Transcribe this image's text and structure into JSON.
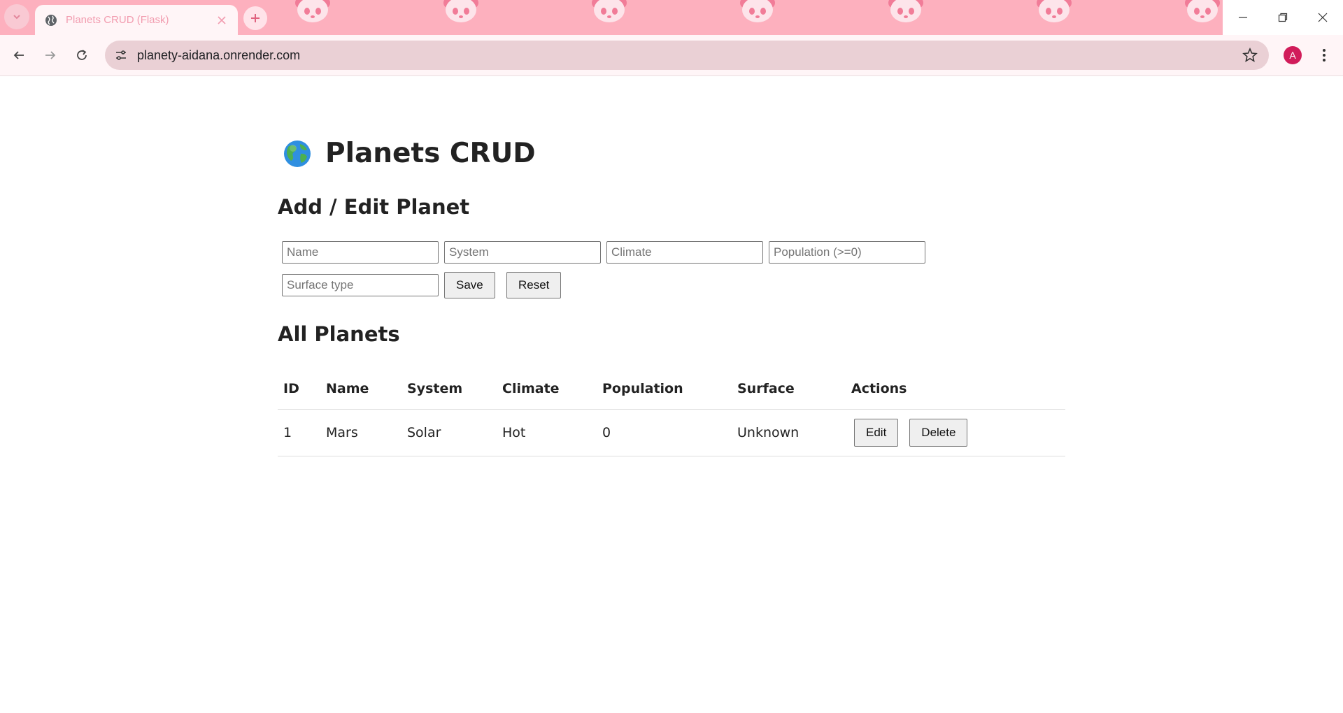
{
  "browser": {
    "tab_title": "Planets CRUD (Flask)",
    "url": "planety-aidana.onrender.com",
    "profile_initial": "A",
    "theme_color": "#fdb0be"
  },
  "page": {
    "title": "Planets CRUD",
    "form_heading": "Add / Edit Planet",
    "list_heading": "All Planets"
  },
  "form": {
    "name_placeholder": "Name",
    "system_placeholder": "System",
    "climate_placeholder": "Climate",
    "population_placeholder": "Population (>=0)",
    "surface_placeholder": "Surface type",
    "save_label": "Save",
    "reset_label": "Reset"
  },
  "table": {
    "headers": [
      "ID",
      "Name",
      "System",
      "Climate",
      "Population",
      "Surface",
      "Actions"
    ],
    "rows": [
      {
        "id": "1",
        "name": "Mars",
        "system": "Solar",
        "climate": "Hot",
        "population": "0",
        "surface": "Unknown",
        "edit_label": "Edit",
        "delete_label": "Delete"
      }
    ]
  }
}
